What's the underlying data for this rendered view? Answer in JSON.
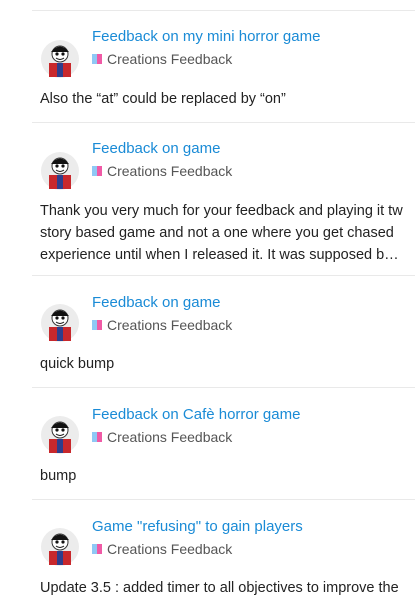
{
  "colors": {
    "link": "#1a8bd6",
    "category_left": "#8fc8f5",
    "category_right": "#f05aa6",
    "divider": "#e9e9e9"
  },
  "posts": [
    {
      "topic": "Feedback on my mini horror game",
      "category": "Creations Feedback",
      "excerpt": [
        "Also the “at” could be replaced by “on”"
      ]
    },
    {
      "topic": "Feedback on game",
      "category": "Creations Feedback",
      "excerpt": [
        "Thank you very much for your feedback and playing it tw",
        "story based game and not a one where you get chased",
        "experience until when I released it. It was supposed b…"
      ]
    },
    {
      "topic": "Feedback on game",
      "category": "Creations Feedback",
      "excerpt": [
        "quick bump"
      ]
    },
    {
      "topic": "Feedback on Cafè horror game",
      "category": "Creations Feedback",
      "excerpt": [
        "bump"
      ]
    },
    {
      "topic": "Game \"refusing\" to gain players",
      "category": "Creations Feedback",
      "excerpt": [
        "Update 3.5 : added timer to all objectives to improve the"
      ]
    }
  ]
}
